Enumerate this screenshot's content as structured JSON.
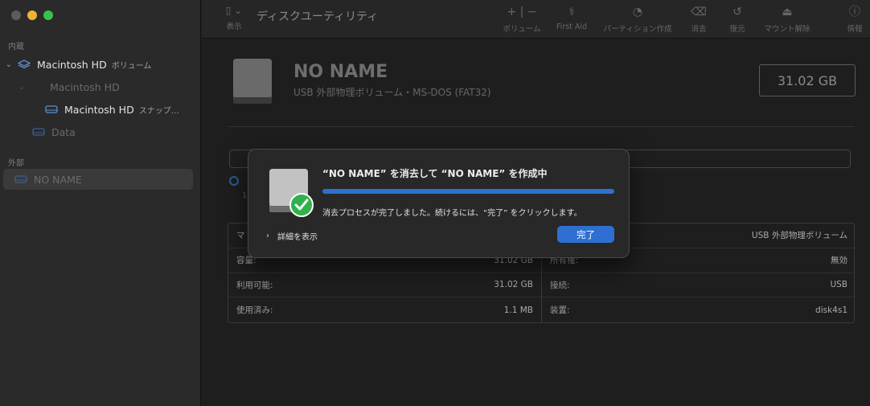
{
  "sidebar": {
    "section_internal": "内蔵",
    "section_external": "外部",
    "items": [
      {
        "name": "Macintosh HD",
        "sub": "ボリューム"
      },
      {
        "name": "Macintosh HD",
        "sub": ""
      },
      {
        "name": "Macintosh HD",
        "sub": "スナップ…"
      },
      {
        "name": "Data",
        "sub": ""
      },
      {
        "name": "NO NAME",
        "sub": ""
      }
    ]
  },
  "toolbar": {
    "title": "ディスクユーティリティ",
    "view_label": "表示",
    "buttons": [
      {
        "label": "ボリューム",
        "icon": "plus-minus-icon"
      },
      {
        "label": "First Aid",
        "icon": "stethoscope-icon"
      },
      {
        "label": "パーティション作成",
        "icon": "pie-chart-icon"
      },
      {
        "label": "消去",
        "icon": "erase-icon"
      },
      {
        "label": "復元",
        "icon": "restore-icon"
      },
      {
        "label": "マウント解除",
        "icon": "eject-icon"
      },
      {
        "label": "情報",
        "icon": "info-icon"
      }
    ]
  },
  "disk": {
    "title": "NO NAME",
    "subtitle": "USB 外部物理ボリューム・MS-DOS (FAT32)",
    "size": "31.02 GB",
    "legend_number": "1"
  },
  "info": {
    "left": [
      {
        "label": "マ",
        "value": ""
      },
      {
        "label": "容量:",
        "value": "31.02 GB"
      },
      {
        "label": "利用可能:",
        "value": "31.02 GB"
      },
      {
        "label": "使用済み:",
        "value": "1.1 MB"
      }
    ],
    "right": [
      {
        "label": "",
        "value": "USB 外部物理ボリューム"
      },
      {
        "label": "所有権:",
        "value": "無効"
      },
      {
        "label": "接続:",
        "value": "USB"
      },
      {
        "label": "装置:",
        "value": "disk4s1"
      }
    ]
  },
  "dialog": {
    "title": "“NO NAME” を消去して “NO NAME” を作成中",
    "progress": 1.0,
    "message": "消去プロセスが完了しました。続けるには、“完了” をクリックします。",
    "details_label": "詳細を表示",
    "done_label": "完了"
  },
  "colors": {
    "accent": "#2f6fd1",
    "traffic_close": "#5c5c5c",
    "traffic_min": "#f2b134",
    "traffic_max": "#38c149",
    "check_green": "#2fb24c"
  }
}
